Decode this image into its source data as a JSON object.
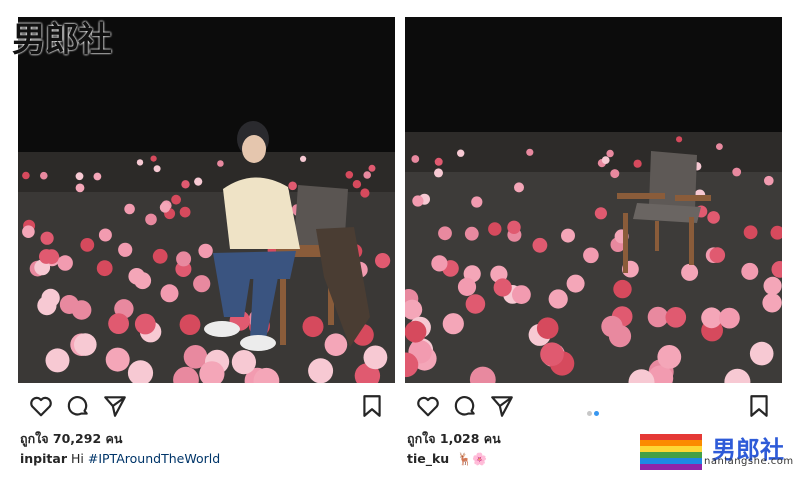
{
  "watermark": {
    "text": "男郎社"
  },
  "posts": [
    {
      "likes_label": "ถูกใจ 70,292 คน",
      "username": "inpitar",
      "caption_text": "Hi",
      "hashtag": "#IPTAroundTheWorld",
      "icons": [
        "heart-icon",
        "comment-icon",
        "share-icon",
        "bookmark-icon"
      ]
    },
    {
      "likes_label": "ถูกใจ 1,028 คน",
      "username": "tie_ku",
      "caption_text": "",
      "emoji": "🦌🌸",
      "icons": [
        "heart-icon",
        "comment-icon",
        "share-icon",
        "bookmark-icon"
      ],
      "carousel": {
        "count": 2,
        "active": 2
      }
    }
  ],
  "brand": {
    "name": "男郎社",
    "url": "nanlangshe.com"
  },
  "colors": {
    "hashtag": "#003569",
    "active_dot": "#3897f0",
    "brand": "#2e5bd8"
  }
}
